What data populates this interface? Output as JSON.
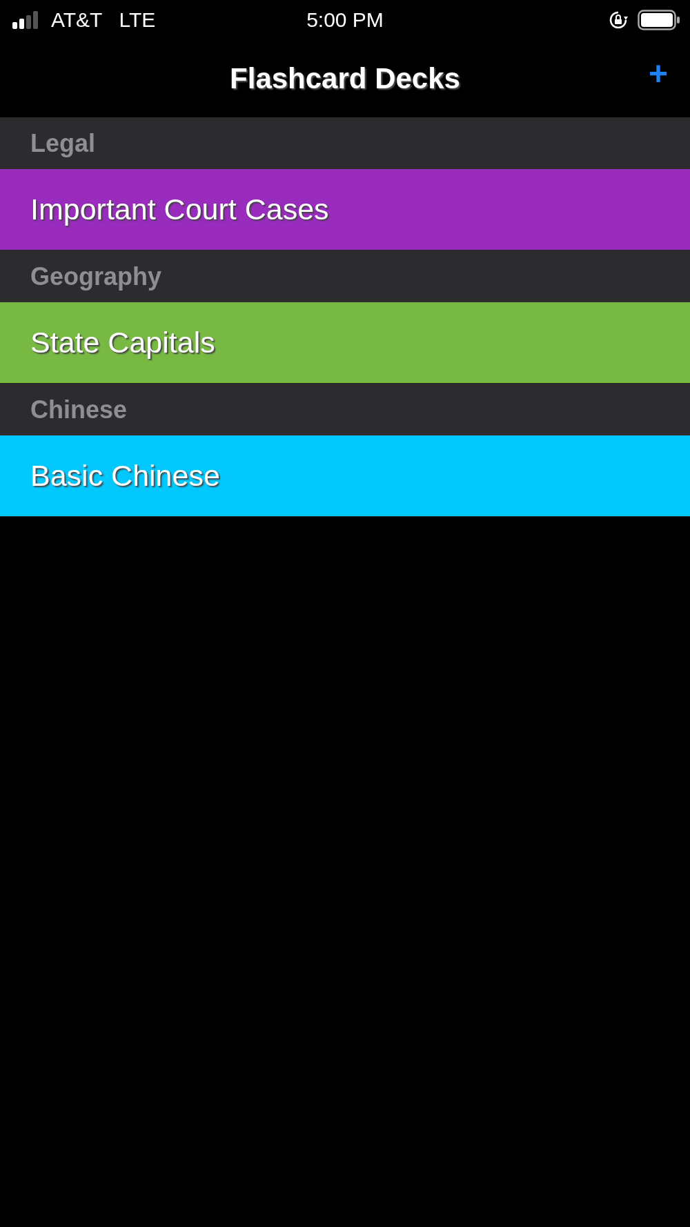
{
  "status_bar": {
    "carrier": "AT&T",
    "network": "LTE",
    "time": "5:00 PM"
  },
  "nav_bar": {
    "title": "Flashcard Decks",
    "add_button": "+"
  },
  "sections": [
    {
      "title": "Legal",
      "decks": [
        {
          "name": "Important Court Cases",
          "color": "#992bbd"
        }
      ]
    },
    {
      "title": "Geography",
      "decks": [
        {
          "name": "State Capitals",
          "color": "#78b943"
        }
      ]
    },
    {
      "title": "Chinese",
      "decks": [
        {
          "name": "Basic Chinese",
          "color": "#02c8fd"
        }
      ]
    }
  ]
}
